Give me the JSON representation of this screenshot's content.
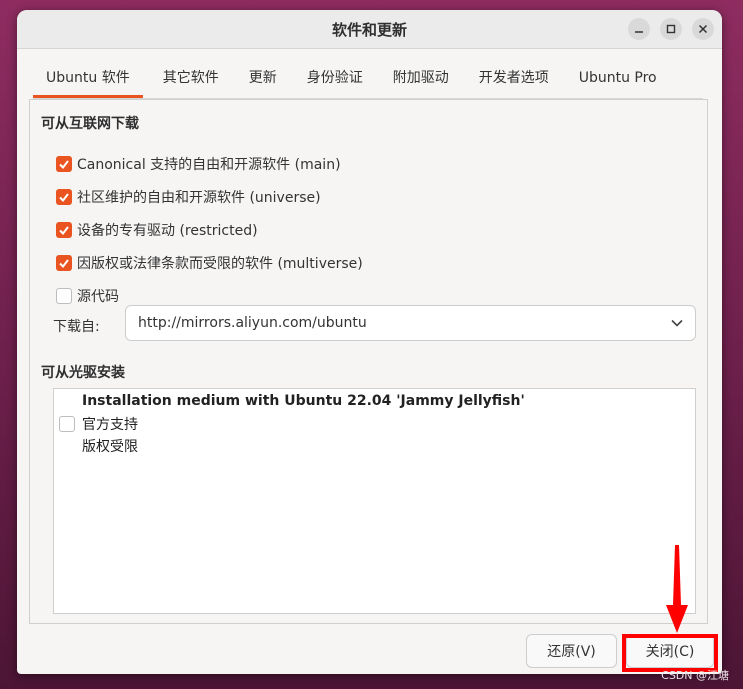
{
  "window": {
    "title": "软件和更新"
  },
  "tabs": [
    {
      "label": "Ubuntu 软件",
      "active": true
    },
    {
      "label": "其它软件"
    },
    {
      "label": "更新"
    },
    {
      "label": "身份验证"
    },
    {
      "label": "附加驱动"
    },
    {
      "label": "开发者选项"
    },
    {
      "label": "Ubuntu Pro"
    }
  ],
  "internet": {
    "heading": "可从互联网下载",
    "options": [
      {
        "label": "Canonical 支持的自由和开源软件 (main)",
        "checked": true
      },
      {
        "label": "社区维护的自由和开源软件 (universe)",
        "checked": true
      },
      {
        "label": "设备的专有驱动 (restricted)",
        "checked": true
      },
      {
        "label": "因版权或法律条款而受限的软件 (multiverse)",
        "checked": true
      },
      {
        "label": "源代码",
        "checked": false
      }
    ],
    "download_from_label": "下载自:",
    "download_from_value": "http://mirrors.aliyun.com/ubuntu"
  },
  "cdrom": {
    "heading": "可从光驱安装",
    "item_title": "Installation medium with Ubuntu 22.04 'Jammy Jellyfish'",
    "item_line1": "官方支持",
    "item_line2": "版权受限",
    "checked": false
  },
  "buttons": {
    "revert": "还原(V)",
    "close": "关闭(C)"
  },
  "watermark": "CSDN @江塘",
  "colors": {
    "accent": "#e95420",
    "annotation": "#ff0000"
  }
}
